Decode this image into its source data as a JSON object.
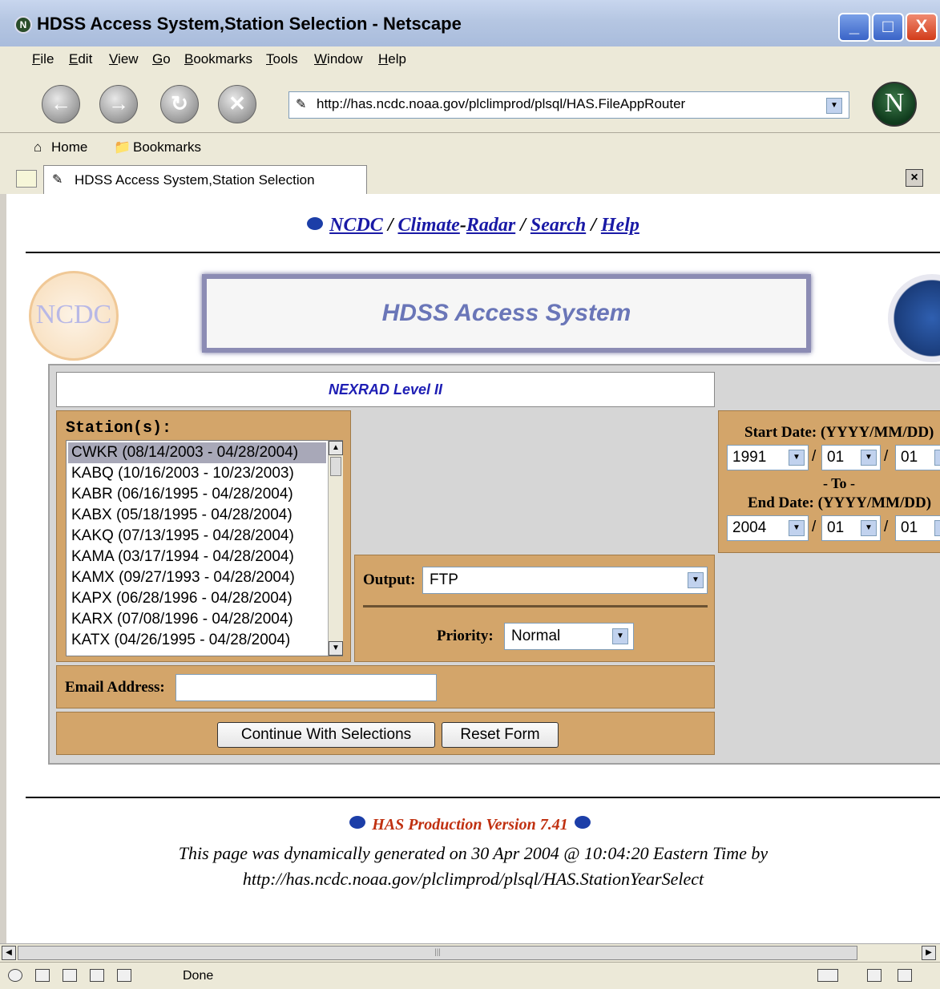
{
  "window": {
    "title": "HDSS Access System,Station Selection - Netscape",
    "buttons": [
      "_",
      "□",
      "X"
    ]
  },
  "menu": [
    {
      "key": "F",
      "rest": "ile"
    },
    {
      "key": "E",
      "rest": "dit"
    },
    {
      "key": "V",
      "rest": "iew"
    },
    {
      "key": "G",
      "rest": "o"
    },
    {
      "key": "B",
      "rest": "ookmarks"
    },
    {
      "key": "T",
      "rest": "ools"
    },
    {
      "key": "W",
      "rest": "indow"
    },
    {
      "key": "H",
      "rest": "elp"
    }
  ],
  "nav": {
    "url": "http://has.ncdc.noaa.gov/plclimprod/plsql/HAS.FileAppRouter",
    "logo": "N"
  },
  "personal_toolbar": {
    "home": "Home",
    "bookmarks": "Bookmarks"
  },
  "tab": {
    "title": "HDSS Access System,Station Selection"
  },
  "page": {
    "topnav": {
      "ncdc": "NCDC",
      "climate": "Climate",
      "dash": "-",
      "radar": "Radar",
      "search": "Search",
      "help": "Help",
      "sep": " / "
    },
    "ncdc_logo": "NCDC",
    "banner": "HDSS Access System",
    "dataset": "NEXRAD Level II",
    "station_label": "Station(s):",
    "stations": [
      "CWKR (08/14/2003 - 04/28/2004)",
      "KABQ (10/16/2003 - 10/23/2003)",
      "KABR (06/16/1995 - 04/28/2004)",
      "KABX (05/18/1995 - 04/28/2004)",
      "KAKQ (07/13/1995 - 04/28/2004)",
      "KAMA (03/17/1994 - 04/28/2004)",
      "KAMX (09/27/1993 - 04/28/2004)",
      "KAPX (06/28/1996 - 04/28/2004)",
      "KARX (07/08/1996 - 04/28/2004)",
      "KATX (04/26/1995 - 04/28/2004)"
    ],
    "selected_station_index": 0,
    "output": {
      "label": "Output:",
      "value": "FTP"
    },
    "priority": {
      "label": "Priority:",
      "value": "Normal"
    },
    "dates": {
      "start_label": "Start Date: (YYYY/MM/DD)",
      "start": {
        "year": "1991",
        "month": "01",
        "day": "01"
      },
      "to": "- To -",
      "end_label": "End Date: (YYYY/MM/DD)",
      "end": {
        "year": "2004",
        "month": "01",
        "day": "01"
      },
      "slash": "/"
    },
    "email_label": "Email Address:",
    "email_value": "",
    "continue_button": "Continue With Selections",
    "reset_button": "Reset Form",
    "footer": {
      "version": "HAS Production Version 7.41",
      "line1": "This page was dynamically generated on 30 Apr 2004 @ 10:04:20 Eastern Time by",
      "line2": "http://has.ncdc.noaa.gov/plclimprod/plsql/HAS.StationYearSelect"
    }
  },
  "status": {
    "text": "Done"
  }
}
